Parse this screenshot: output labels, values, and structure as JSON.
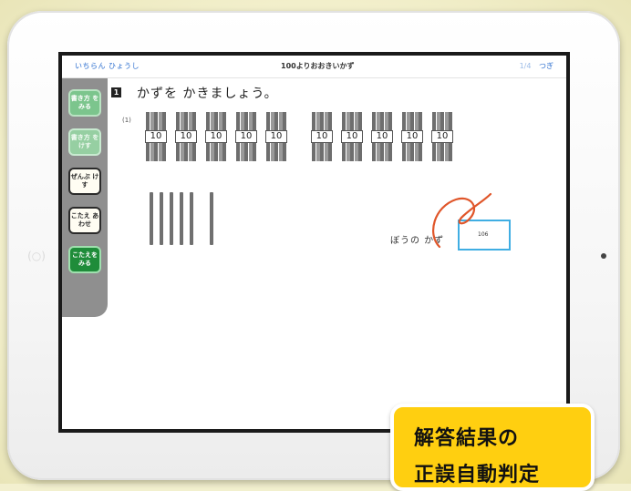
{
  "topbar": {
    "left_link": "いちらん ひょうし",
    "title": "100よりおおきいかず",
    "page_indicator": "1/4",
    "next_label": "つぎ"
  },
  "sidebar": {
    "buttons": [
      {
        "label": "書き方 をみる"
      },
      {
        "label": "書き方 をけす"
      },
      {
        "label": "ぜんぶ けす"
      },
      {
        "label": "こたえ あわせ"
      },
      {
        "label": "こたえを みる"
      }
    ]
  },
  "question": {
    "number": "1",
    "instruction": "かずを かきましょう。",
    "sub_number": "(1)",
    "bundle_label": "10",
    "answer_label": "ぼうの かず",
    "answer_value": "106"
  },
  "badge": {
    "line1": "解答結果の",
    "line2": "正誤自動判定"
  },
  "colors": {
    "accent_blue": "#2d6fcf",
    "answer_border": "#40aee3",
    "sidebar_green": "#7cc58d",
    "sidebar_dark_green": "#1f8c3a",
    "correct_mark": "#e0562a",
    "badge_yellow": "#ffcf10"
  },
  "icons": {
    "camera": "camera-icon",
    "home_button": "home-button-icon",
    "correct_mark": "circle-check-mark-icon"
  }
}
